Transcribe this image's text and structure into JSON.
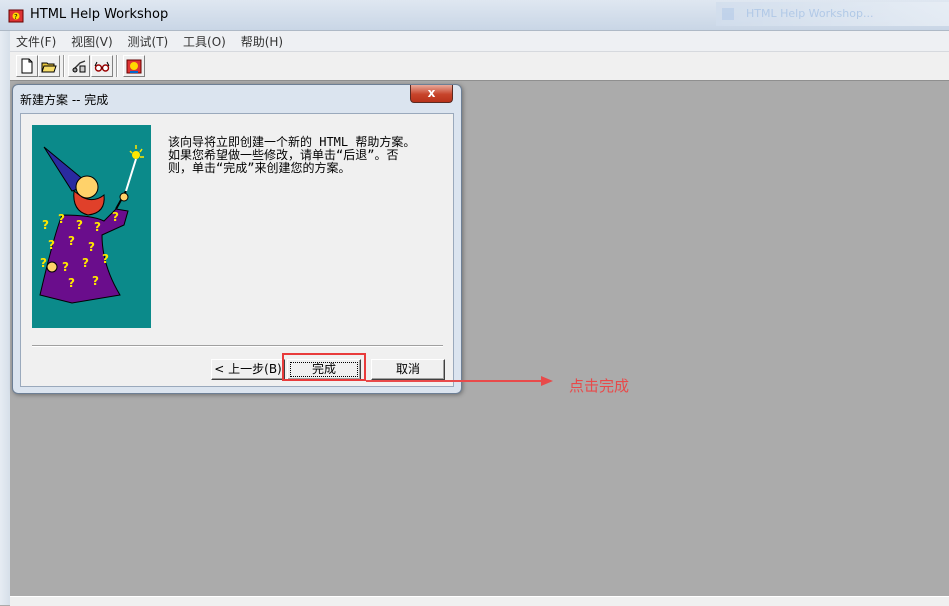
{
  "window": {
    "title": "HTML Help Workshop",
    "ghost_title": "HTML Help Workshop..."
  },
  "menu": [
    {
      "label": "文件(F)"
    },
    {
      "label": "视图(V)"
    },
    {
      "label": "测试(T)"
    },
    {
      "label": "工具(O)"
    },
    {
      "label": "帮助(H)"
    }
  ],
  "toolbar": {
    "icons": [
      "new-file-icon",
      "open-folder-icon",
      "compile-icon",
      "view-compiled-icon",
      "help-wizard-icon"
    ]
  },
  "dialog": {
    "title": "新建方案 -- 完成",
    "close_glyph": "x",
    "text_lines": [
      "该向导将立即创建一个新的 HTML 帮助方案。",
      "如果您希望做一些修改，请单击“后退”。否",
      "则，单击“完成”来创建您的方案。"
    ],
    "buttons": {
      "back": "< 上一步(B)",
      "finish": "完成",
      "cancel": "取消"
    }
  },
  "annotation": {
    "text": "点击完成",
    "color": "#e84a4a"
  },
  "colors": {
    "workspace": "#ababab",
    "wizard_bg": "#0b8a8a",
    "robe": "#6a0d8c",
    "beard": "#e0402a"
  }
}
